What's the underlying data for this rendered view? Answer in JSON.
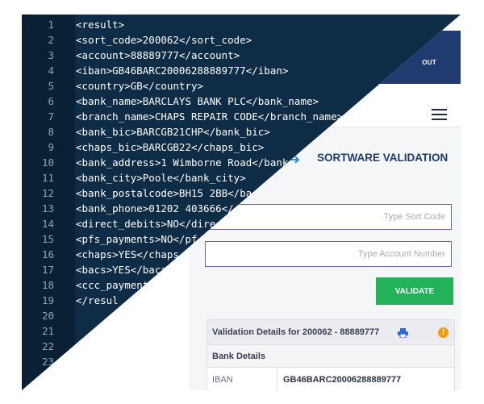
{
  "editor": {
    "lines": [
      {
        "n": "1",
        "text": "<result>"
      },
      {
        "n": "2",
        "text": "<sort_code>200062</sort_code>"
      },
      {
        "n": "3",
        "text": "<account>88889777</account>"
      },
      {
        "n": "4",
        "text": "<iban>GB46BARC20006288889777</iban>"
      },
      {
        "n": "5",
        "text": "<country>GB</country>"
      },
      {
        "n": "6",
        "text": "<bank_name>BARCLAYS BANK PLC</bank_name>"
      },
      {
        "n": "7",
        "text": "<branch_name>CHAPS REPAIR CODE</branch_name>"
      },
      {
        "n": "8",
        "text": "<bank_bic>BARCGB21CHP</bank_bic>"
      },
      {
        "n": "9",
        "text": "<chaps_bic>BARCGB22</chaps_bic>"
      },
      {
        "n": "10",
        "text": "<bank_address>1 Wimborne Road</bank"
      },
      {
        "n": "11",
        "text": "<bank_city>Poole</bank_city>"
      },
      {
        "n": "12",
        "text": "<bank_postalcode>BH15 2BB</ba"
      },
      {
        "n": "13",
        "text": "<bank_phone>01202 403666</"
      },
      {
        "n": "14",
        "text": "<direct_debits>NO</dire"
      },
      {
        "n": "15",
        "text": "<pfs_payments>NO</pf"
      },
      {
        "n": "16",
        "text": "<chaps>YES</chaps"
      },
      {
        "n": "17",
        "text": "<bacs>YES</baca"
      },
      {
        "n": "18",
        "text": "<ccc_payment"
      },
      {
        "n": "19",
        "text": "</resul"
      },
      {
        "n": "20",
        "text": ""
      },
      {
        "n": "21",
        "text": ""
      },
      {
        "n": "22",
        "text": ""
      },
      {
        "n": "23",
        "text": ""
      }
    ]
  },
  "web": {
    "nav_link": "OUT",
    "section_title": "SORTWARE VALIDATION",
    "sort_code_placeholder": "Type Sort Code",
    "account_placeholder": "Type Account Number",
    "validate_label": "VALIDATE",
    "results_title": "Validation Details for 200062 - 88889777",
    "warn_symbol": "!",
    "bank_details_label": "Bank Details",
    "row": {
      "key": "IBAN",
      "value": "GB46BARC20006288889777"
    }
  },
  "colors": {
    "editor_bg": "#0e2c46",
    "navbar": "#1f3b70",
    "validate_green": "#23b25a",
    "warning_orange": "#f39c12"
  }
}
